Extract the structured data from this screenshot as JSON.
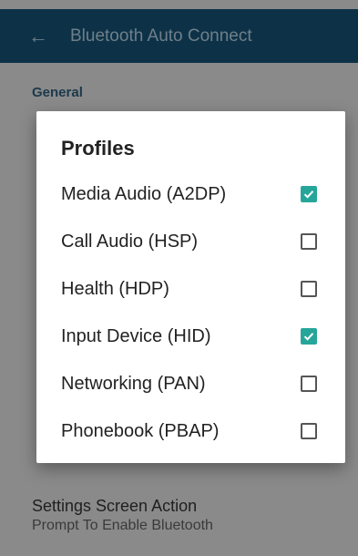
{
  "app_bar": {
    "back_icon": "arrow-left-icon",
    "title": "Bluetooth Auto Connect"
  },
  "settings": {
    "section_header": "General",
    "items": [
      {
        "title": "Settings Screen Action",
        "subtitle": "Prompt To Enable Bluetooth"
      }
    ]
  },
  "dialog": {
    "title": "Profiles",
    "options": [
      {
        "label": "Media Audio (A2DP)",
        "checked": true
      },
      {
        "label": "Call Audio (HSP)",
        "checked": false
      },
      {
        "label": "Health (HDP)",
        "checked": false
      },
      {
        "label": "Input Device (HID)",
        "checked": true
      },
      {
        "label": "Networking (PAN)",
        "checked": false
      },
      {
        "label": "Phonebook (PBAP)",
        "checked": false
      }
    ]
  },
  "colors": {
    "app_bar": "#0d3248",
    "accent": "#26a69a",
    "scrim_background": "#8a8a8a"
  }
}
